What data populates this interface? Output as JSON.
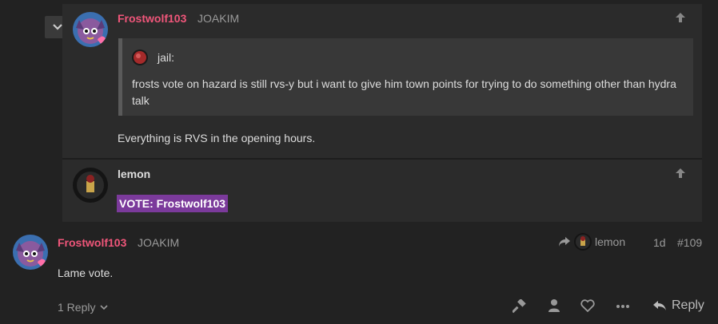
{
  "embedded": {
    "post1": {
      "username": "Frostwolf103",
      "fullname": "JOAKIM",
      "quote": {
        "author": "jail:",
        "text": "frosts vote on hazard is still rvs-y but i want to give him town points for trying to do something other than hydra talk"
      },
      "body": "Everything is RVS in the opening hours."
    },
    "post2": {
      "username": "lemon",
      "body": "VOTE: Frostwolf103"
    }
  },
  "main_post": {
    "username": "Frostwolf103",
    "fullname": "JOAKIM",
    "reply_to": "lemon",
    "age": "1d",
    "post_number": "#109",
    "body": "Lame vote.",
    "replies_label": "1 Reply",
    "reply_button": "Reply"
  },
  "icons": [
    "chevron-down-icon",
    "arrow-up-icon",
    "share-arrow-icon",
    "hammer-icon",
    "user-icon",
    "heart-icon",
    "more-icon",
    "reply-icon"
  ],
  "colors": {
    "username": "#f0567a",
    "vote_highlight": "#7b3a9b",
    "background": "#222222"
  }
}
